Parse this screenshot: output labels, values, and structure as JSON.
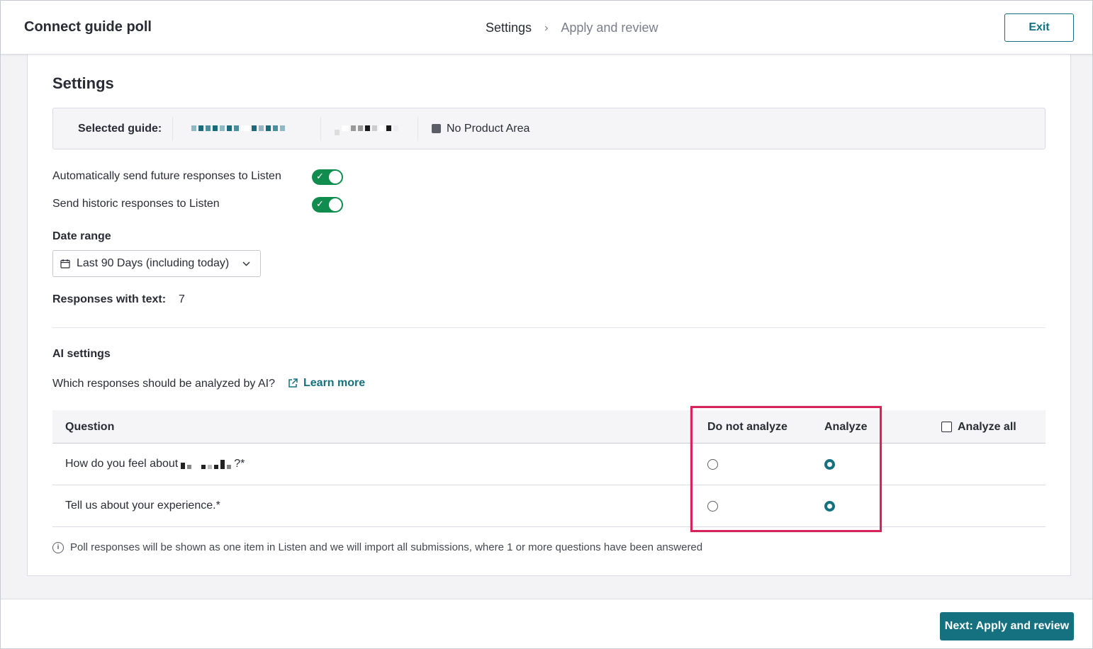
{
  "header": {
    "title": "Connect guide poll",
    "steps": [
      "Settings",
      "Apply and review"
    ],
    "step_separator": "›",
    "exit_label": "Exit"
  },
  "settings": {
    "title": "Settings",
    "selected_guide_label": "Selected guide:",
    "product_area": "No Product Area",
    "auto_send_label": "Automatically send future responses to Listen",
    "auto_send_on": true,
    "historic_label": "Send historic responses to Listen",
    "historic_on": true,
    "date_range_label": "Date range",
    "date_range_value": "Last 90 Days (including today)",
    "responses_label": "Responses with text:",
    "responses_count": "7"
  },
  "ai": {
    "title": "AI settings",
    "question": "Which responses should be analyzed by AI?",
    "learn_more": "Learn more",
    "columns": {
      "question": "Question",
      "do_not_analyze": "Do not analyze",
      "analyze": "Analyze",
      "analyze_all": "Analyze all"
    },
    "rows": [
      {
        "question_prefix": "How do you feel about",
        "question_suffix": "?*",
        "selection": "analyze"
      },
      {
        "question_prefix": "Tell us about your experience.*",
        "question_suffix": "",
        "selection": "analyze"
      }
    ],
    "note": "Poll responses will be shown as one item in Listen and we will import all submissions, where 1 or more questions have been answered"
  },
  "footer": {
    "next_label": "Next: Apply and review"
  },
  "colors": {
    "accent": "#15707f",
    "toggle_on": "#0f8c4e",
    "highlight": "#d8235a"
  }
}
